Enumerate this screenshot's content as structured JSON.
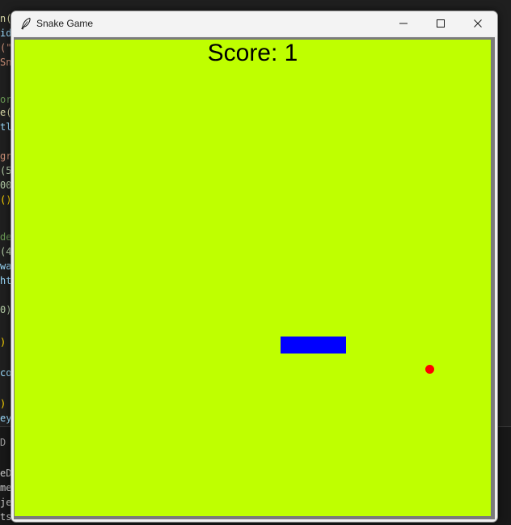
{
  "window": {
    "title": "Snake Game",
    "app_icon": "feather-icon",
    "controls": [
      "minimize-icon",
      "maximize-icon",
      "close-icon"
    ]
  },
  "game": {
    "score_text": "Score: 1",
    "score": 1,
    "background_color": "#bfff00",
    "snake": {
      "color": "#0000ff",
      "length_segments": 4,
      "direction": "horizontal"
    },
    "food": {
      "color": "#ff0000",
      "shape": "circle"
    }
  },
  "background_editor": {
    "line_fragments": [
      {
        "text": "n(",
        "color": "#dcdcaa"
      },
      {
        "text": "id",
        "color": "#9cdcfe"
      },
      {
        "text": "(\"",
        "color": "#ce9178"
      },
      {
        "text": "Sn",
        "color": "#ce9178"
      },
      {
        "text": "",
        "color": "#d4d4d4"
      },
      {
        "text": "or",
        "color": "#6a9955"
      },
      {
        "text": "e(",
        "color": "#dcdcaa"
      },
      {
        "text": "tl",
        "color": "#9cdcfe"
      },
      {
        "text": "",
        "color": "#d4d4d4"
      },
      {
        "text": "gr",
        "color": "#ce9178"
      },
      {
        "text": "(5",
        "color": "#b5cea8"
      },
      {
        "text": "00",
        "color": "#b5cea8"
      },
      {
        "text": "()",
        "color": "#ffd700"
      },
      {
        "text": "",
        "color": "#d4d4d4"
      },
      {
        "text": "de",
        "color": "#6a9955"
      },
      {
        "text": "(4",
        "color": "#b5cea8"
      },
      {
        "text": "wa",
        "color": "#9cdcfe"
      },
      {
        "text": "ht",
        "color": "#9cdcfe"
      },
      {
        "text": "",
        "color": "#d4d4d4"
      },
      {
        "text": "0)",
        "color": "#b5cea8"
      },
      {
        "text": "",
        "color": "#d4d4d4"
      },
      {
        "text": ")",
        "color": "#ffd700"
      },
      {
        "text": "",
        "color": "#d4d4d4"
      },
      {
        "text": "co",
        "color": "#9cdcfe"
      },
      {
        "text": "",
        "color": "#d4d4d4"
      },
      {
        "text": ")",
        "color": "#ffd700"
      },
      {
        "text": "ey",
        "color": "#9cdcfe"
      },
      {
        "text": "",
        "color": "#d4d4d4"
      },
      {
        "text": "D",
        "color": "#9d9d9d"
      },
      {
        "text": "",
        "color": "#d4d4d4"
      },
      {
        "text": "eD",
        "color": "#cccccc"
      },
      {
        "text": "me",
        "color": "#cccccc"
      },
      {
        "text": "je",
        "color": "#cccccc"
      },
      {
        "text": "ts",
        "color": "#cccccc"
      }
    ]
  }
}
